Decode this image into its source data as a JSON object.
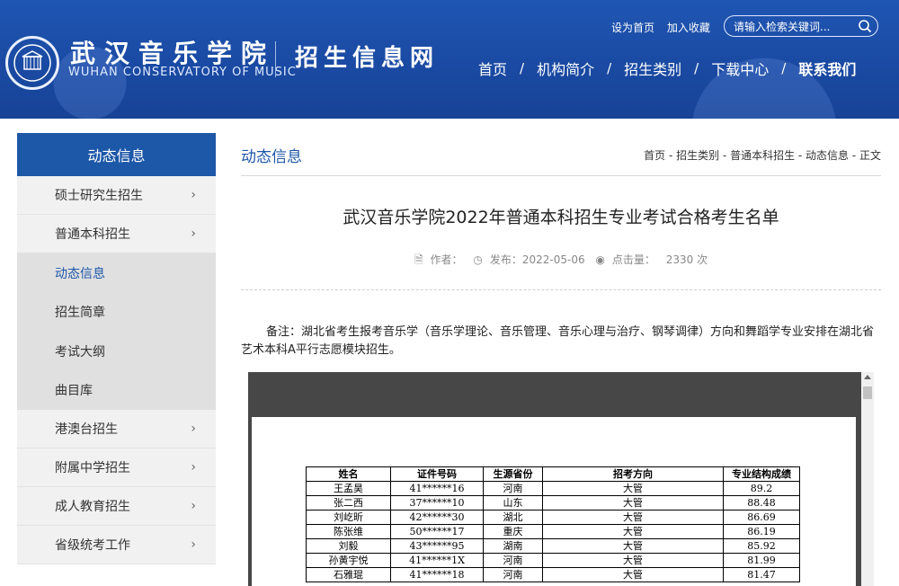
{
  "header": {
    "logo_cn": "武汉音乐学院",
    "logo_en": "WUHAN CONSERVATORY OF MUSIC",
    "site_name": "招生信息网",
    "top_links": [
      "设为首页",
      "加入收藏"
    ],
    "search_placeholder": "请输入检索关键词...",
    "nav": [
      "首页",
      "机构简介",
      "招生类别",
      "下载中心",
      "联系我们"
    ]
  },
  "sidebar": {
    "title": "动态信息",
    "items": [
      {
        "label": "硕士研究生招生",
        "type": "main"
      },
      {
        "label": "普通本科招生",
        "type": "main"
      },
      {
        "label": "动态信息",
        "type": "sub",
        "active": true
      },
      {
        "label": "招生简章",
        "type": "sub"
      },
      {
        "label": "考试大纲",
        "type": "sub"
      },
      {
        "label": "曲目库",
        "type": "sub"
      },
      {
        "label": "港澳台招生",
        "type": "main"
      },
      {
        "label": "附属中学招生",
        "type": "main"
      },
      {
        "label": "成人教育招生",
        "type": "main"
      },
      {
        "label": "省级统考工作",
        "type": "main"
      }
    ]
  },
  "content": {
    "section_title": "动态信息",
    "breadcrumb": "首页 - 招生类别 - 普通本科招生 - 动态信息 - 正文",
    "article_title": "武汉音乐学院2022年普通本科招生专业考试合格考生名单",
    "meta": {
      "author_label": "作者：",
      "date_label": "发布：2022-05-06",
      "views_label": "点击量：",
      "views": "2330 次"
    },
    "note": "备注：湖北省考生报考音乐学（音乐学理论、音乐管理、音乐心理与治疗、钢琴调律）方向和舞蹈学专业安排在湖北省艺术本科A平行志愿模块招生。"
  },
  "table": {
    "headers": [
      "姓名",
      "证件号码",
      "生源省份",
      "招考方向",
      "专业结构成绩"
    ],
    "rows": [
      [
        "王孟昊",
        "41******16",
        "河南",
        "大管",
        "89.2"
      ],
      [
        "张二西",
        "37******10",
        "山东",
        "大管",
        "88.48"
      ],
      [
        "刘屹昕",
        "42******30",
        "湖北",
        "大管",
        "86.69"
      ],
      [
        "陈张维",
        "50******17",
        "重庆",
        "大管",
        "86.19"
      ],
      [
        "刘毅",
        "43******95",
        "湖南",
        "大管",
        "85.92"
      ],
      [
        "孙黄宇悦",
        "41******1X",
        "河南",
        "大管",
        "81.99"
      ],
      [
        "石雅琨",
        "41******18",
        "河南",
        "大管",
        "81.47"
      ]
    ]
  },
  "colors": {
    "header_blue": "#1a4aa3",
    "accent": "#1d57a8"
  }
}
